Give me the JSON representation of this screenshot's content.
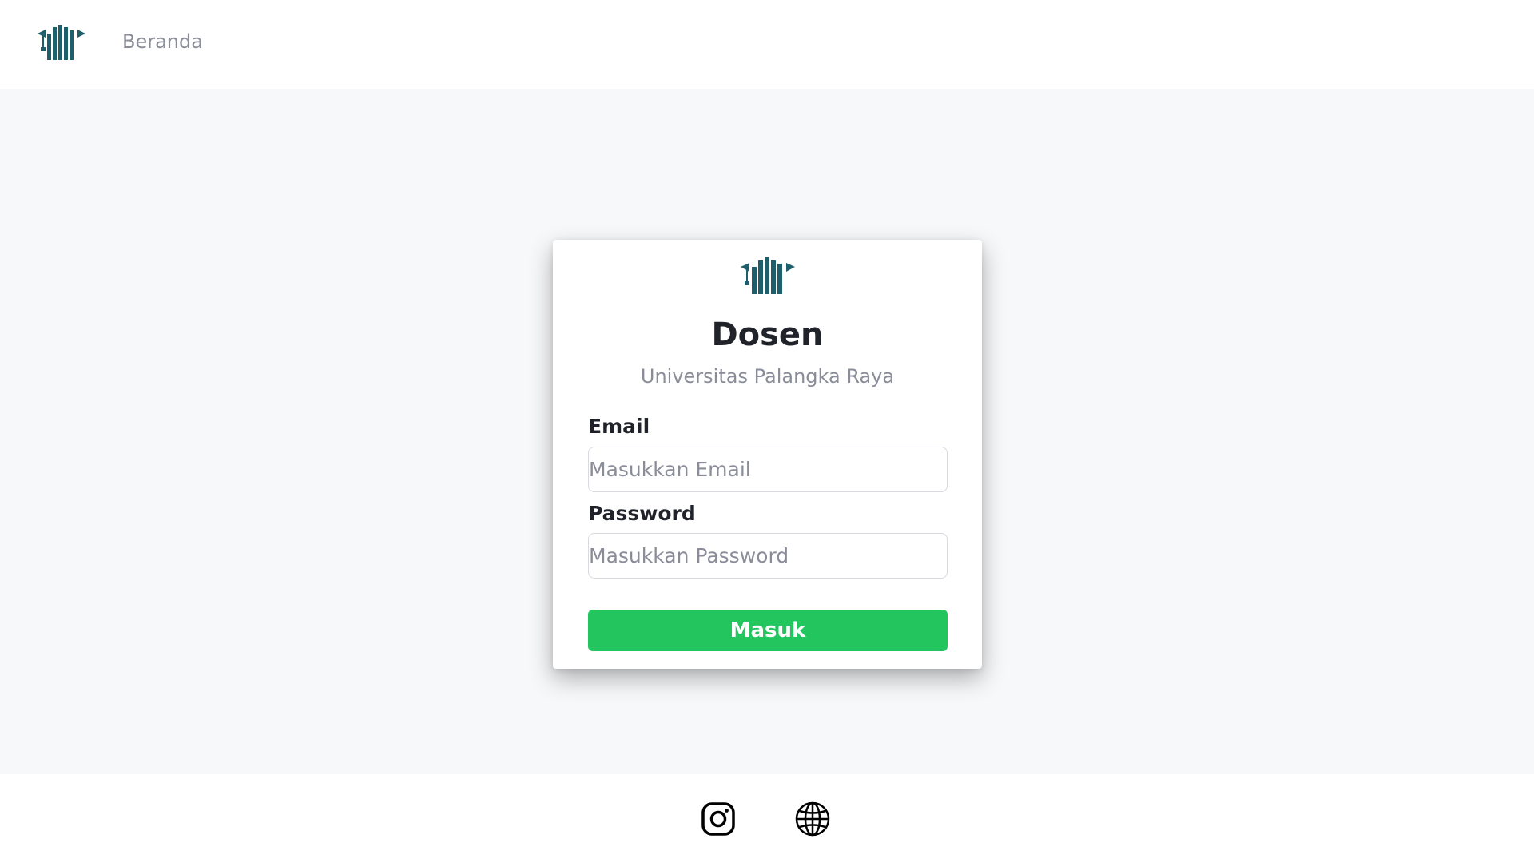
{
  "navbar": {
    "logo_icon": "graduation-cap-logo-icon",
    "home_link": "Beranda"
  },
  "login": {
    "logo_icon": "graduation-cap-logo-icon",
    "title": "Dosen",
    "subtitle": "Universitas Palangka Raya",
    "email_label": "Email",
    "email_placeholder": "Masukkan Email",
    "email_value": "",
    "password_label": "Password",
    "password_placeholder": "Masukkan Password",
    "password_value": "",
    "submit_label": "Masuk"
  },
  "footer": {
    "links": [
      {
        "icon": "instagram-icon"
      },
      {
        "icon": "globe-icon"
      }
    ]
  },
  "colors": {
    "brand": "#1f5f6b",
    "accent": "#22c55e",
    "background": "#f7f8fa",
    "text": "#20232a",
    "muted": "#8a8d99"
  }
}
